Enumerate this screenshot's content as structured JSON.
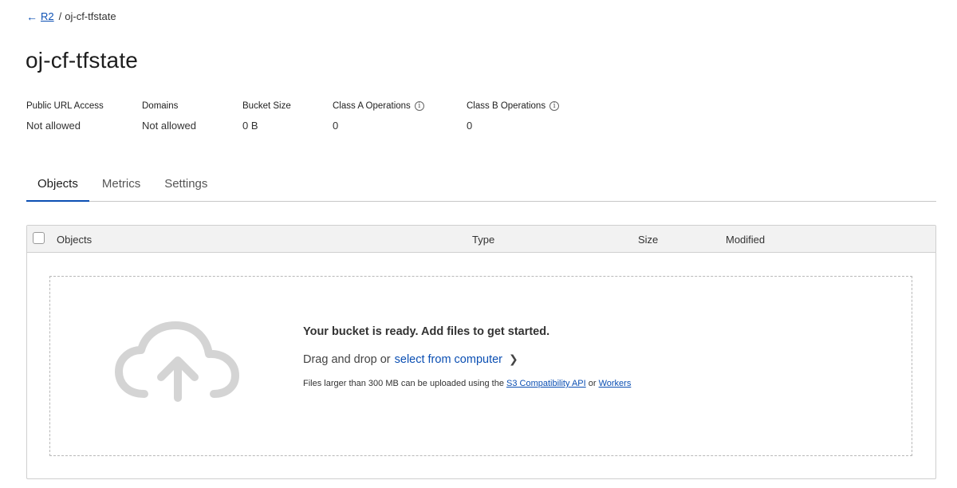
{
  "breadcrumb": {
    "parent": "R2",
    "separator": "/",
    "current": "oj-cf-tfstate"
  },
  "title": "oj-cf-tfstate",
  "stats": [
    {
      "label": "Public URL Access",
      "value": "Not allowed",
      "info": false
    },
    {
      "label": "Domains",
      "value": "Not allowed",
      "info": false
    },
    {
      "label": "Bucket Size",
      "value": "0 B",
      "info": false
    },
    {
      "label": "Class A Operations",
      "value": "0",
      "info": true
    },
    {
      "label": "Class B Operations",
      "value": "0",
      "info": true
    }
  ],
  "tabs": [
    {
      "label": "Objects",
      "active": true
    },
    {
      "label": "Metrics",
      "active": false
    },
    {
      "label": "Settings",
      "active": false
    }
  ],
  "table": {
    "columns": [
      "Objects",
      "Type",
      "Size",
      "Modified"
    ]
  },
  "dropzone": {
    "title": "Your bucket is ready. Add files to get started.",
    "drag_text": "Drag and drop or",
    "select_link": "select from computer",
    "note_prefix": "Files larger than 300 MB can be uploaded using the",
    "note_link1": "S3 Compatibility API",
    "note_or": "or",
    "note_link2": "Workers"
  },
  "colors": {
    "accent": "#0b4fb3",
    "icon_gray": "#d4d4d4"
  }
}
